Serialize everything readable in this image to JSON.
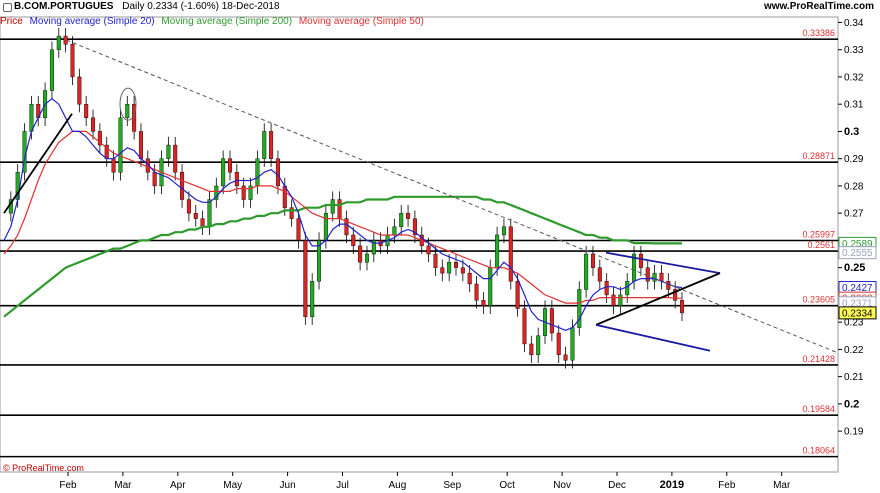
{
  "header": {
    "symbol": "B.COM.PORTUGUES",
    "info": "Daily   0.2334 (-1.60%)   18-Dec-2018",
    "brand": "www.ProRealTime.com"
  },
  "legend": [
    {
      "label": "Price",
      "color": "#c00000"
    },
    {
      "label": "Moving average (Simple 20)",
      "color": "#2222cc"
    },
    {
      "label": "Moving average (Simple 200)",
      "color": "#2e9a2e"
    },
    {
      "label": "Moving average (Simple 50)",
      "color": "#e03030"
    }
  ],
  "footer": "© ProRealTime.com",
  "chart_data": {
    "type": "line",
    "ylim": [
      0.175,
      0.342
    ],
    "y_ticks": [
      0.34,
      0.33,
      0.32,
      0.31,
      0.3,
      0.29,
      0.28,
      0.27,
      0.26,
      0.25,
      0.23,
      0.22,
      0.21,
      0.2,
      0.19
    ],
    "y_tick_labels": [
      "0.34",
      "0.33",
      "0.32",
      "0.31",
      "0.3",
      "0.29",
      "0.28",
      "0.27",
      "0.26",
      "0.25",
      "0.23",
      "0.22",
      "0.21",
      "0.2",
      "0.19"
    ],
    "bold_ticks": [
      "0.3",
      "0.25",
      "0.2"
    ],
    "x_labels": [
      "Feb",
      "Mar",
      "Apr",
      "May",
      "Jun",
      "Jul",
      "Aug",
      "Sep",
      "Oct",
      "Nov",
      "Dec",
      "2019",
      "Feb",
      "Mar"
    ],
    "bold_x_labels": [
      "2019"
    ],
    "support_lines": [
      {
        "value": 0.33386,
        "label": "0.33386"
      },
      {
        "value": 0.28871,
        "label": "0.28871"
      },
      {
        "value": 0.25997,
        "label": "0.25997"
      },
      {
        "value": 0.2561,
        "label": "0.2561"
      },
      {
        "value": 0.23605,
        "label": "0.23605"
      },
      {
        "value": 0.21428,
        "label": "0.21428"
      },
      {
        "value": 0.19584,
        "label": "0.19584"
      },
      {
        "value": 0.18064,
        "label": "0.18064"
      }
    ],
    "right_badges": [
      {
        "value": 0.2589,
        "label": "0.2589",
        "color": "#2e9a2e",
        "bg": "#ffffff"
      },
      {
        "value": 0.2555,
        "label": "0.2555",
        "color": "#9aa3c0",
        "bg": "#ffffff"
      },
      {
        "value": 0.2427,
        "label": "0.2427",
        "color": "#2222cc",
        "bg": "#ffffff"
      },
      {
        "value": 0.2388,
        "label": "0.2388",
        "color": "#e03030",
        "bg": "#ffffff"
      },
      {
        "value": 0.2371,
        "label": "0.2371",
        "color": "#9aa3c0",
        "bg": "#ffffff"
      },
      {
        "value": 0.2334,
        "label": "0.2334",
        "color": "#000000",
        "bg": "#ffff55"
      }
    ],
    "price": [
      0.27,
      0.275,
      0.285,
      0.3,
      0.31,
      0.305,
      0.315,
      0.33,
      0.335,
      0.332,
      0.32,
      0.31,
      0.305,
      0.3,
      0.295,
      0.29,
      0.285,
      0.305,
      0.31,
      0.3,
      0.29,
      0.285,
      0.28,
      0.29,
      0.295,
      0.285,
      0.275,
      0.27,
      0.268,
      0.265,
      0.275,
      0.28,
      0.29,
      0.285,
      0.28,
      0.275,
      0.28,
      0.29,
      0.3,
      0.29,
      0.28,
      0.272,
      0.268,
      0.26,
      0.232,
      0.245,
      0.26,
      0.27,
      0.275,
      0.268,
      0.262,
      0.258,
      0.252,
      0.255,
      0.26,
      0.258,
      0.262,
      0.265,
      0.27,
      0.268,
      0.262,
      0.258,
      0.255,
      0.25,
      0.248,
      0.252,
      0.25,
      0.248,
      0.244,
      0.238,
      0.236,
      0.25,
      0.262,
      0.265,
      0.245,
      0.235,
      0.222,
      0.218,
      0.225,
      0.235,
      0.226,
      0.218,
      0.216,
      0.228,
      0.242,
      0.255,
      0.25,
      0.245,
      0.24,
      0.236,
      0.24,
      0.245,
      0.255,
      0.25,
      0.245,
      0.248,
      0.245,
      0.242,
      0.238,
      0.2334
    ],
    "ma20": [
      0.26,
      0.265,
      0.275,
      0.29,
      0.3,
      0.305,
      0.31,
      0.312,
      0.31,
      0.305,
      0.3,
      0.3,
      0.298,
      0.295,
      0.292,
      0.29,
      0.29,
      0.292,
      0.294,
      0.293,
      0.29,
      0.288,
      0.285,
      0.284,
      0.283,
      0.281,
      0.279,
      0.277,
      0.275,
      0.274,
      0.274,
      0.276,
      0.279,
      0.281,
      0.282,
      0.282,
      0.282,
      0.283,
      0.285,
      0.286,
      0.284,
      0.28,
      0.276,
      0.27,
      0.262,
      0.258,
      0.258,
      0.26,
      0.264,
      0.266,
      0.266,
      0.264,
      0.262,
      0.26,
      0.259,
      0.259,
      0.26,
      0.261,
      0.263,
      0.264,
      0.263,
      0.261,
      0.259,
      0.257,
      0.255,
      0.254,
      0.253,
      0.252,
      0.25,
      0.248,
      0.246,
      0.246,
      0.249,
      0.252,
      0.25,
      0.246,
      0.24,
      0.234,
      0.231,
      0.23,
      0.229,
      0.228,
      0.227,
      0.228,
      0.231,
      0.236,
      0.24,
      0.242,
      0.243,
      0.243,
      0.242,
      0.243,
      0.245,
      0.246,
      0.246,
      0.246,
      0.245,
      0.244,
      0.243,
      0.2427
    ],
    "ma50": [
      0.255,
      0.258,
      0.262,
      0.268,
      0.275,
      0.282,
      0.288,
      0.292,
      0.296,
      0.298,
      0.3,
      0.3,
      0.3,
      0.298,
      0.296,
      0.294,
      0.292,
      0.291,
      0.29,
      0.289,
      0.288,
      0.287,
      0.286,
      0.285,
      0.284,
      0.283,
      0.282,
      0.281,
      0.28,
      0.279,
      0.278,
      0.278,
      0.278,
      0.278,
      0.279,
      0.279,
      0.279,
      0.28,
      0.28,
      0.28,
      0.279,
      0.278,
      0.276,
      0.274,
      0.272,
      0.27,
      0.269,
      0.268,
      0.268,
      0.268,
      0.267,
      0.266,
      0.265,
      0.264,
      0.263,
      0.262,
      0.262,
      0.262,
      0.262,
      0.262,
      0.261,
      0.26,
      0.259,
      0.258,
      0.257,
      0.256,
      0.255,
      0.254,
      0.253,
      0.252,
      0.251,
      0.25,
      0.25,
      0.25,
      0.249,
      0.248,
      0.246,
      0.244,
      0.242,
      0.24,
      0.239,
      0.238,
      0.237,
      0.237,
      0.237,
      0.238,
      0.238,
      0.239,
      0.239,
      0.239,
      0.239,
      0.239,
      0.239,
      0.239,
      0.239,
      0.239,
      0.239,
      0.239,
      0.2388,
      0.2388
    ],
    "ma200": [
      0.232,
      0.234,
      0.236,
      0.238,
      0.24,
      0.242,
      0.244,
      0.246,
      0.248,
      0.25,
      0.251,
      0.252,
      0.253,
      0.254,
      0.255,
      0.256,
      0.257,
      0.257,
      0.258,
      0.259,
      0.26,
      0.26,
      0.261,
      0.262,
      0.262,
      0.263,
      0.263,
      0.264,
      0.264,
      0.265,
      0.265,
      0.266,
      0.266,
      0.267,
      0.267,
      0.268,
      0.268,
      0.269,
      0.269,
      0.27,
      0.27,
      0.271,
      0.271,
      0.271,
      0.272,
      0.272,
      0.272,
      0.273,
      0.273,
      0.273,
      0.274,
      0.274,
      0.274,
      0.275,
      0.275,
      0.275,
      0.275,
      0.276,
      0.276,
      0.276,
      0.276,
      0.276,
      0.276,
      0.276,
      0.276,
      0.276,
      0.276,
      0.276,
      0.276,
      0.276,
      0.275,
      0.275,
      0.274,
      0.274,
      0.273,
      0.272,
      0.271,
      0.27,
      0.269,
      0.268,
      0.267,
      0.266,
      0.265,
      0.264,
      0.263,
      0.262,
      0.262,
      0.261,
      0.261,
      0.26,
      0.26,
      0.26,
      0.259,
      0.259,
      0.259,
      0.2589,
      0.2589,
      0.2589,
      0.2589,
      0.2589
    ]
  }
}
